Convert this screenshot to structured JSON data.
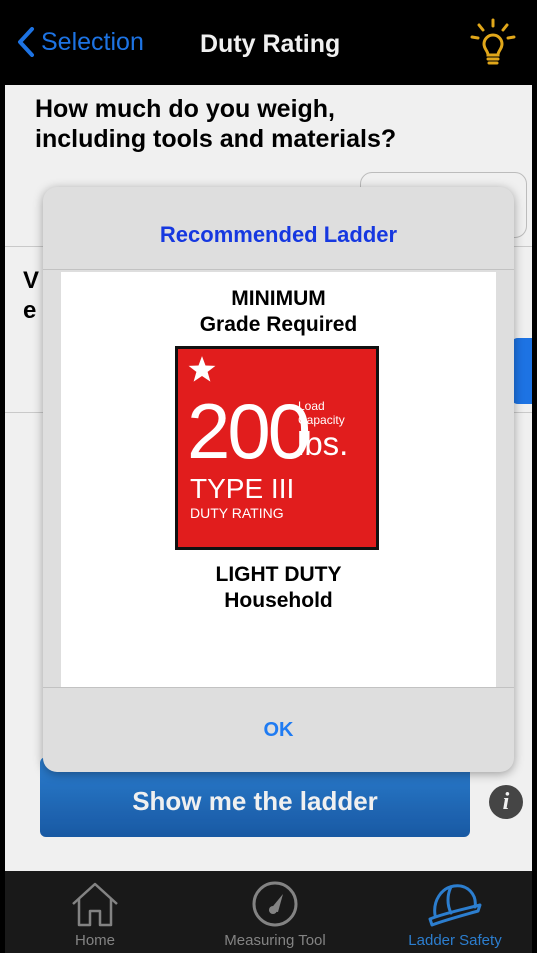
{
  "nav": {
    "back_label": "Selection",
    "title": "Duty Rating",
    "tip_icon": "lightbulb-icon"
  },
  "question": {
    "line1": "How much do you weigh,",
    "line2": "including tools and materials?"
  },
  "second_question_partial": {
    "line1": "V",
    "line2": "e"
  },
  "show_button_label": "Show me the ladder",
  "info_label": "i",
  "tabs": [
    {
      "label": "Home",
      "icon": "home-icon",
      "active": false
    },
    {
      "label": "Measuring Tool",
      "icon": "gauge-icon",
      "active": false
    },
    {
      "label": "Ladder Safety",
      "icon": "hard-hat-icon",
      "active": true
    }
  ],
  "dialog": {
    "title": "Recommended Ladder",
    "heading_line1": "MINIMUM",
    "heading_line2": "Grade Required",
    "badge": {
      "capacity_value": "200",
      "capacity_label_line1": "Load",
      "capacity_label_line2": "Capacity",
      "unit": "lbs.",
      "type": "TYPE III",
      "type_caption": "DUTY RATING",
      "color": "#e11d1d"
    },
    "footer_line1": "LIGHT DUTY",
    "footer_line2": "Household",
    "ok_label": "OK"
  },
  "colors": {
    "accent": "#1f7bf2",
    "dialog_title": "#1638e0",
    "tab_active": "#2f86dc"
  }
}
